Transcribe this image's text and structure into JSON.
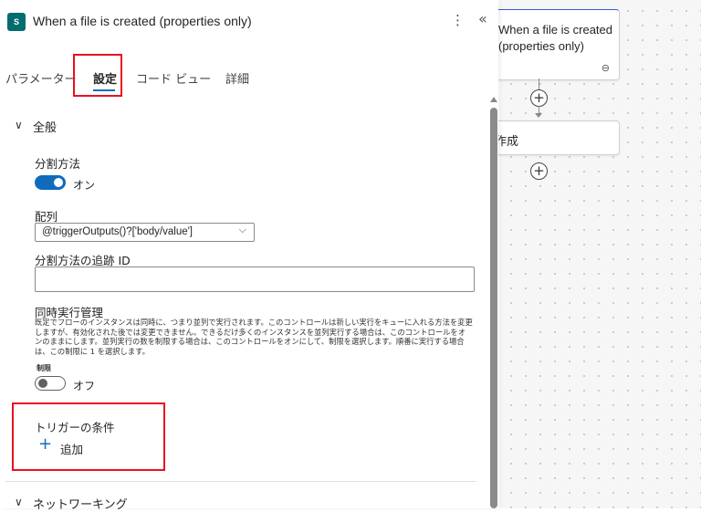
{
  "header": {
    "title": "When a file is created (properties only)",
    "more_glyph": "⋮",
    "collapse_glyph": "«",
    "app_icon": "sharepoint-icon",
    "app_icon_text": "S"
  },
  "tabs": [
    "パラメーター",
    "設定",
    "コード ビュー",
    "詳細"
  ],
  "active_tab": "設定",
  "general": {
    "section_title": "全般",
    "split_label": "分割方法",
    "split_toggle_text": "オン",
    "array_label": "配列",
    "array_value": "@triggerOutputs()?['body/value']",
    "tracking_label": "分割方法の追跡 ID",
    "tracking_value": "",
    "concurrency_label": "同時実行管理",
    "concurrency_desc": "既定でフローのインスタンスは同時に、つまり並列で実行されます。このコントロールは新しい実行をキューに入れる方法を変更しますが、有効化された後では変更できません。できるだけ多くのインスタンスを並列実行する場合は、このコントロールをオンのままにします。並列実行の数を制限する場合は、このコントロールをオンにして、制限を選択します。順番に実行する場合は、この制限に 1 を選択します。",
    "limit_label": "制限",
    "limit_toggle_text": "オフ",
    "trigger_conditions_label": "トリガーの条件",
    "add_label": "追加"
  },
  "networking": {
    "section_title": "ネットワーキング"
  },
  "canvas": {
    "card1_title": "When a file is created (properties only)",
    "card2_title": "作成"
  },
  "colors": {
    "accent": "#0f6cbd",
    "highlight": "#e81123",
    "sharepoint": "#036c70"
  }
}
